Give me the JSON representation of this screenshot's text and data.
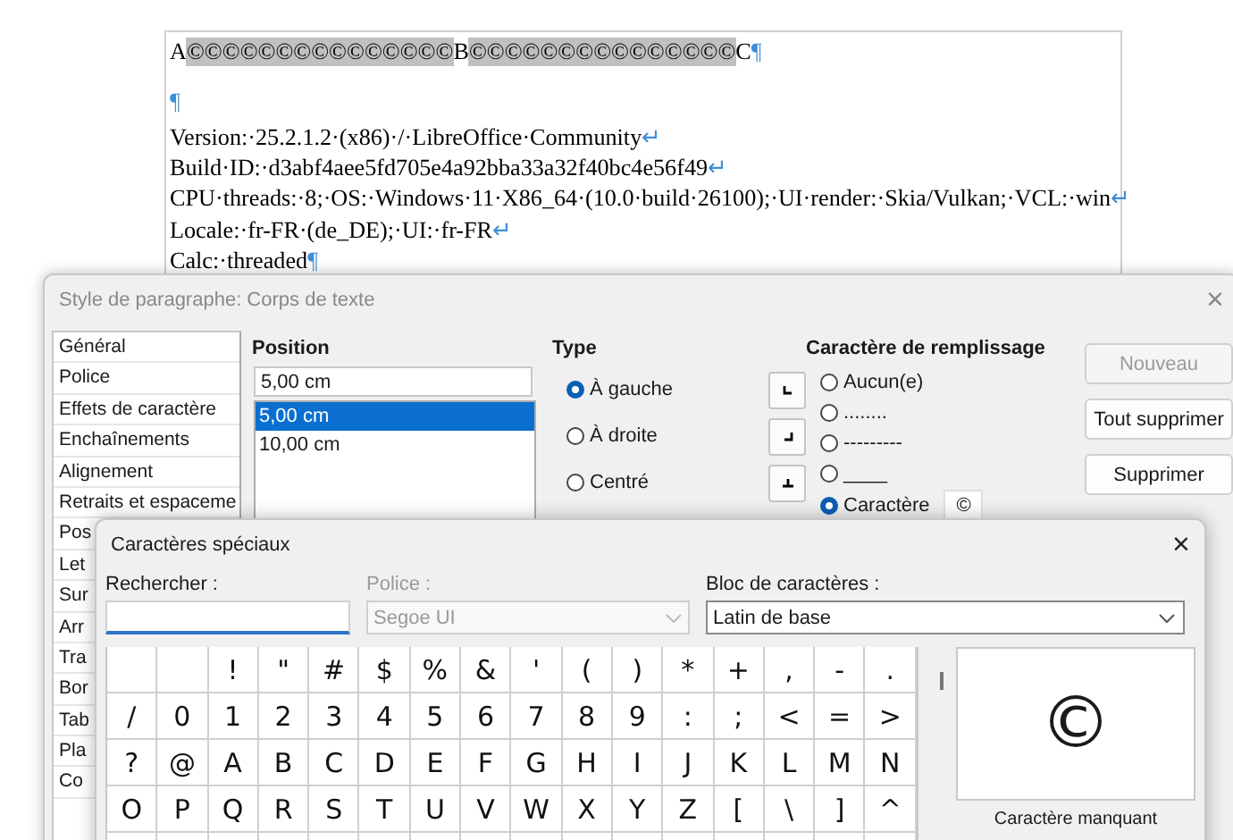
{
  "document": {
    "lines": [
      {
        "segments": [
          {
            "text": "A",
            "shaded": false
          },
          {
            "text": "©©©©©©©©©©©©©©©",
            "shaded": true
          },
          {
            "text": "B",
            "shaded": false
          },
          {
            "text": "©©©©©©©©©©©©©©©",
            "shaded": true
          },
          {
            "text": "C",
            "shaded": false
          }
        ],
        "mark": "¶"
      },
      {
        "mark": "¶"
      },
      {
        "segments": [
          {
            "text": "Version:·25.2.1.2·(x86)·/·LibreOffice·Community",
            "shaded": false
          }
        ],
        "mark": "↵"
      },
      {
        "segments": [
          {
            "text": "Build·ID:·d3abf4aee5fd705e4a92bba33a32f40bc4e56f49",
            "shaded": false
          }
        ],
        "mark": "↵"
      },
      {
        "segments": [
          {
            "text": "CPU·threads:·8;·OS:·Windows·11·X86_64·(10.0·build·26100);·UI·render:·Skia/Vulkan;·VCL:·win",
            "shaded": false
          }
        ],
        "mark": "↵"
      },
      {
        "segments": [
          {
            "text": "Locale:·fr-FR·(de_DE);·UI:·fr-FR",
            "shaded": false
          }
        ],
        "mark": "↵"
      },
      {
        "segments": [
          {
            "text": "Calc:·threaded",
            "shaded": false
          }
        ],
        "mark": "¶"
      }
    ]
  },
  "paragraph_dialog": {
    "title": "Style de paragraphe: Corps de texte",
    "close": "×",
    "sidebar": {
      "items": [
        "Général",
        "Police",
        "Effets de caractère",
        "Enchaînements",
        "Alignement",
        "Retraits et espaceme",
        "Pos",
        "Let",
        "Sur",
        "Arr",
        "Tra",
        "Bor",
        "Tab",
        "Pla",
        "Co"
      ]
    },
    "position": {
      "label": "Position",
      "value": "5,00 cm",
      "items": [
        {
          "label": "5,00 cm",
          "selected": true
        },
        {
          "label": "10,00 cm",
          "selected": false
        }
      ]
    },
    "type": {
      "label": "Type",
      "options": [
        {
          "label": "À gauche",
          "kind": "left",
          "selected": true
        },
        {
          "label": "À droite",
          "kind": "right",
          "selected": false
        },
        {
          "label": "Centré",
          "kind": "center",
          "selected": false
        }
      ]
    },
    "fill": {
      "label": "Caractère de remplissage",
      "options": [
        {
          "label": "Aucun(e)",
          "selected": false
        },
        {
          "label": "........",
          "selected": false
        },
        {
          "label": "---------",
          "selected": false
        },
        {
          "label": "____",
          "selected": false
        },
        {
          "label": "Caractère",
          "selected": true
        }
      ],
      "character": "©"
    },
    "buttons": [
      {
        "label": "Nouveau",
        "disabled": true
      },
      {
        "label": "Tout supprimer",
        "disabled": false
      },
      {
        "label": "Supprimer",
        "disabled": false
      }
    ]
  },
  "special_chars_dialog": {
    "title": "Caractères spéciaux",
    "close": "×",
    "search": {
      "label": "Rechercher :"
    },
    "font": {
      "label": "Police :",
      "value": "Segoe UI",
      "disabled": true
    },
    "block": {
      "label": "Bloc de caractères :",
      "value": "Latin de base"
    },
    "grid": [
      [
        "!",
        "\"",
        "#",
        "$",
        "%",
        "&",
        "'",
        "(",
        ")",
        "*",
        "+",
        ",",
        "-",
        "."
      ],
      [
        "/",
        "0",
        "1",
        "2",
        "3",
        "4",
        "5",
        "6",
        "7",
        "8",
        "9",
        ":",
        ";",
        "<",
        "=",
        ">"
      ],
      [
        "?",
        "@",
        "A",
        "B",
        "C",
        "D",
        "E",
        "F",
        "G",
        "H",
        "I",
        "J",
        "K",
        "L",
        "M",
        "N"
      ],
      [
        "O",
        "P",
        "Q",
        "R",
        "S",
        "T",
        "U",
        "V",
        "W",
        "X",
        "Y",
        "Z",
        "[",
        "\\",
        "]",
        "^"
      ]
    ],
    "preview": {
      "character": "©",
      "caption": "Caractère manquant"
    }
  }
}
